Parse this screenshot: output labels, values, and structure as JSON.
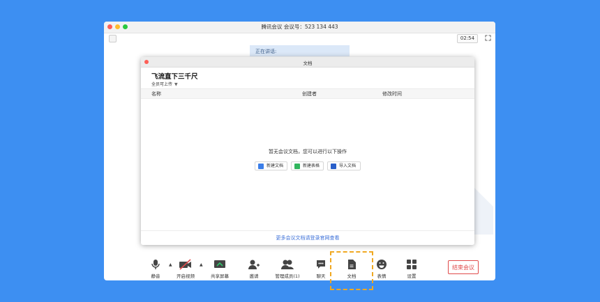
{
  "window": {
    "title": "腾讯会议 会议号：523 134 443",
    "timer": "02:54",
    "speaking": "正在讲话:"
  },
  "docs_panel": {
    "title": "文档",
    "meeting_name": "飞流直下三千尺",
    "upload_permission": "全员可上传",
    "columns": [
      "名称",
      "创建者",
      "修改时间"
    ],
    "empty_message": "暂无会议文档，您可以进行以下操作",
    "actions": [
      {
        "label": "新建文档",
        "color": "#3b7ee8"
      },
      {
        "label": "新建表格",
        "color": "#31b55d"
      },
      {
        "label": "导入文档",
        "color": "#2a5fc9"
      }
    ],
    "footer_link": "更多会议文档请登录官网查看"
  },
  "toolbar": {
    "mute": "静音",
    "video": "开启视频",
    "share": "共享屏幕",
    "invite": "邀请",
    "members": "管理成员(1)",
    "chat": "聊天",
    "docs": "文档",
    "emoji": "表情",
    "settings": "设置",
    "end": "结束会议"
  },
  "colors": {
    "background": "#3d8ff2",
    "end_button": "#e04a4a",
    "highlight": "#f0a821",
    "link": "#3b6fd8"
  }
}
